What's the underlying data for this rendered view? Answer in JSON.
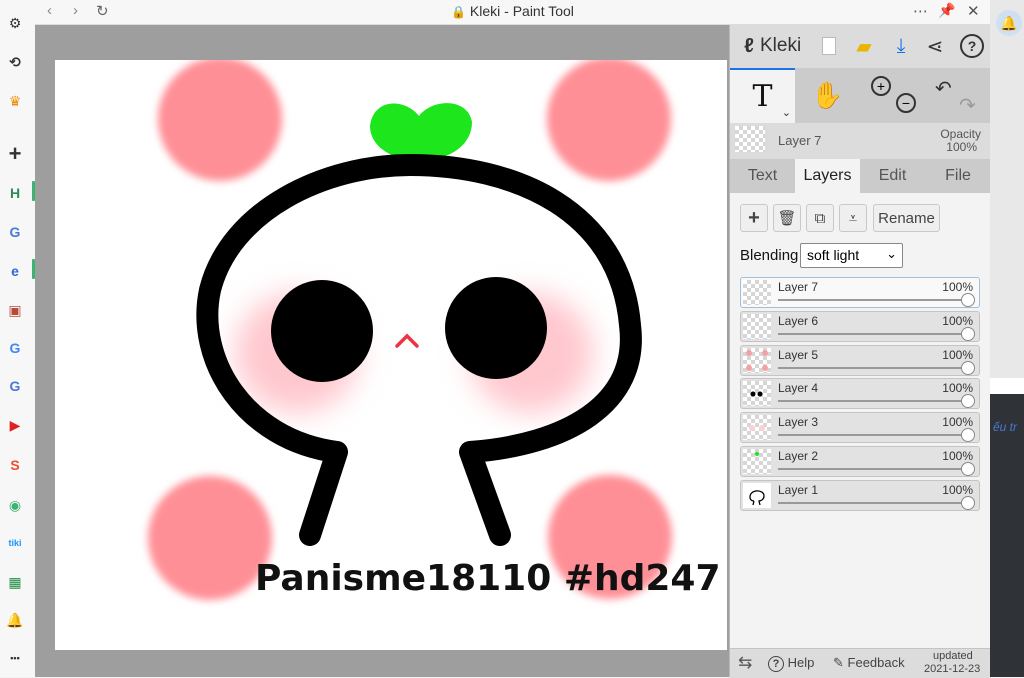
{
  "window": {
    "title": "Kleki - Paint Tool"
  },
  "sidebar": {
    "items": [
      {
        "name": "settings-icon",
        "glyph": "⚙",
        "color": "#333333"
      },
      {
        "name": "history-icon",
        "glyph": "⟲",
        "color": "#333333"
      },
      {
        "name": "crown-icon",
        "glyph": "♛",
        "color": "#f08c00"
      },
      {
        "name": "add-icon",
        "glyph": "+",
        "color": "#333333"
      },
      {
        "name": "h-app-icon",
        "glyph": "H",
        "color": "#2e8b57"
      },
      {
        "name": "translate-icon",
        "glyph": "G",
        "color": "#4a78d6"
      },
      {
        "name": "kleki-app-icon",
        "glyph": "e",
        "color": "#2d6ad6"
      },
      {
        "name": "shield-app-icon",
        "glyph": "▣",
        "color": "#b84a3a"
      },
      {
        "name": "google-icon",
        "glyph": "G",
        "color": "#4285f4"
      },
      {
        "name": "translate-icon-2",
        "glyph": "G",
        "color": "#4a78d6"
      },
      {
        "name": "youtube-icon",
        "glyph": "▶",
        "color": "#d22"
      },
      {
        "name": "shopee-icon",
        "glyph": "S",
        "color": "#ee4d2d"
      },
      {
        "name": "maps-icon",
        "glyph": "◉",
        "color": "#3cb371"
      },
      {
        "name": "tiki-icon",
        "glyph": "tiki",
        "color": "#1a94ff"
      },
      {
        "name": "sheets-icon",
        "glyph": "▦",
        "color": "#1e8e3e"
      },
      {
        "name": "bell-icon",
        "glyph": "🔔",
        "color": "#333333"
      },
      {
        "name": "more-icon",
        "glyph": "•••",
        "color": "#333333"
      }
    ]
  },
  "canvas": {
    "watermark_text": "Panisme18110 #hd247",
    "colors": {
      "blob": "#ff8f96",
      "cheek": "#ffc8cf",
      "sprout": "#1de61d",
      "outline": "#000000",
      "mouth": "#ee3344"
    }
  },
  "panel": {
    "app_name": "Kleki",
    "current_layer": "Layer 7",
    "opacity_label": "Opacity",
    "opacity_value": "100%",
    "tabs": [
      "Text",
      "Layers",
      "Edit",
      "File"
    ],
    "active_tab": "Layers",
    "rename_label": "Rename",
    "blending_label": "Blending",
    "blending_value": "soft light",
    "layers": [
      {
        "name": "Layer 7",
        "opacity": "100%",
        "selected": true
      },
      {
        "name": "Layer 6",
        "opacity": "100%",
        "selected": false
      },
      {
        "name": "Layer 5",
        "opacity": "100%",
        "selected": false
      },
      {
        "name": "Layer 4",
        "opacity": "100%",
        "selected": false
      },
      {
        "name": "Layer 3",
        "opacity": "100%",
        "selected": false
      },
      {
        "name": "Layer 2",
        "opacity": "100%",
        "selected": false
      },
      {
        "name": "Layer 1",
        "opacity": "100%",
        "selected": false
      }
    ],
    "footer": {
      "help": "Help",
      "feedback": "Feedback",
      "updated_label": "updated",
      "updated_date": "2021-12-23"
    },
    "accent": "#1a73e8"
  },
  "right_strip": {
    "text": "ếu tr"
  }
}
